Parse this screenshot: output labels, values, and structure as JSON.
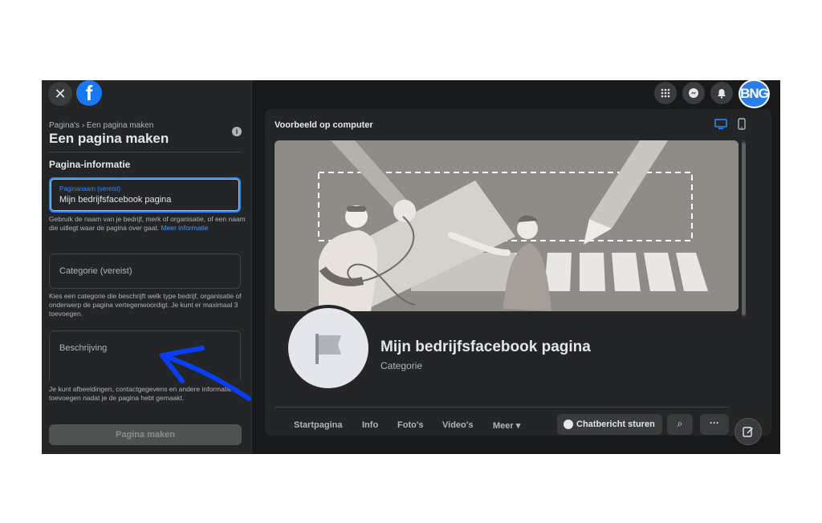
{
  "left_panel": {
    "breadcrumb": "Pagina's › Een pagina maken",
    "title": "Een pagina maken",
    "section_title": "Pagina-informatie",
    "name_field": {
      "label": "Paginanaam (vereist)",
      "value": "Mijn bedrijfsfacebook pagina"
    },
    "name_help": "Gebruik de naam van je bedrijf, merk of organisatie, of een naam die uitlegt waar de pagina over gaat.",
    "name_help_link": "Meer informatie",
    "category_field": {
      "placeholder": "Categorie (vereist)"
    },
    "category_help": "Kies een categorie die beschrijft welk type bedrijf, organisatie of onderwerp de pagina vertegenwoordigt. Je kunt er maximaal 3 toevoegen.",
    "description_field": {
      "placeholder": "Beschrijving"
    },
    "description_help": "Je kunt afbeeldingen, contactgegevens en andere informatie toevoegen nadat je de pagina hebt gemaakt.",
    "create_button": "Pagina maken"
  },
  "top_bar": {
    "close_icon": "close-icon",
    "logo": "f",
    "avatar_text": "BNG"
  },
  "preview": {
    "title": "Voorbeeld op computer",
    "page_name": "Mijn bedrijfsfacebook pagina",
    "page_category": "Categorie",
    "tabs": [
      "Startpagina",
      "Info",
      "Foto's",
      "Video's",
      "Meer ▾"
    ],
    "chat_button": "Chatbericht sturen",
    "search_glyph": "⌕",
    "more_glyph": "···"
  },
  "colors": {
    "accent_blue": "#2d88ff",
    "facebook_blue": "#1877f2",
    "annotation_arrow": "#0a3ef5"
  }
}
